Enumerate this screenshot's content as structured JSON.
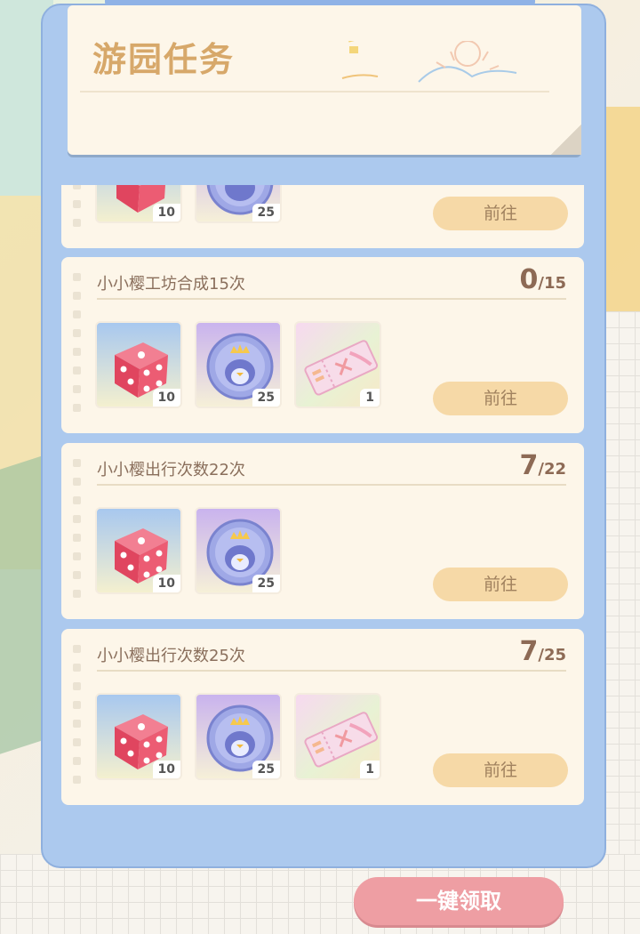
{
  "header": {
    "title": "游园任务"
  },
  "colors": {
    "panel": "#acc9ee",
    "card": "#fdf6e9",
    "go_button": "#f6d9a7",
    "claim_all": "#ee9ea3"
  },
  "tasks": [
    {
      "title": "",
      "progress_current": "",
      "progress_total": "",
      "rewards": [
        {
          "icon": "dice-icon",
          "count": "10"
        },
        {
          "icon": "penguin-coin-icon",
          "count": "25"
        }
      ],
      "go_label": "前往"
    },
    {
      "title": "小小樱工坊合成15次",
      "progress_current": "0",
      "progress_total": "/15",
      "rewards": [
        {
          "icon": "dice-icon",
          "count": "10"
        },
        {
          "icon": "penguin-coin-icon",
          "count": "25"
        },
        {
          "icon": "ticket-icon",
          "count": "1"
        }
      ],
      "go_label": "前往"
    },
    {
      "title": "小小樱出行次数22次",
      "progress_current": "7",
      "progress_total": "/22",
      "rewards": [
        {
          "icon": "dice-icon",
          "count": "10"
        },
        {
          "icon": "penguin-coin-icon",
          "count": "25"
        }
      ],
      "go_label": "前往"
    },
    {
      "title": "小小樱出行次数25次",
      "progress_current": "7",
      "progress_total": "/25",
      "rewards": [
        {
          "icon": "dice-icon",
          "count": "10"
        },
        {
          "icon": "penguin-coin-icon",
          "count": "25"
        },
        {
          "icon": "ticket-icon",
          "count": "1"
        }
      ],
      "go_label": "前往"
    }
  ],
  "claim_all_label": "一键领取"
}
